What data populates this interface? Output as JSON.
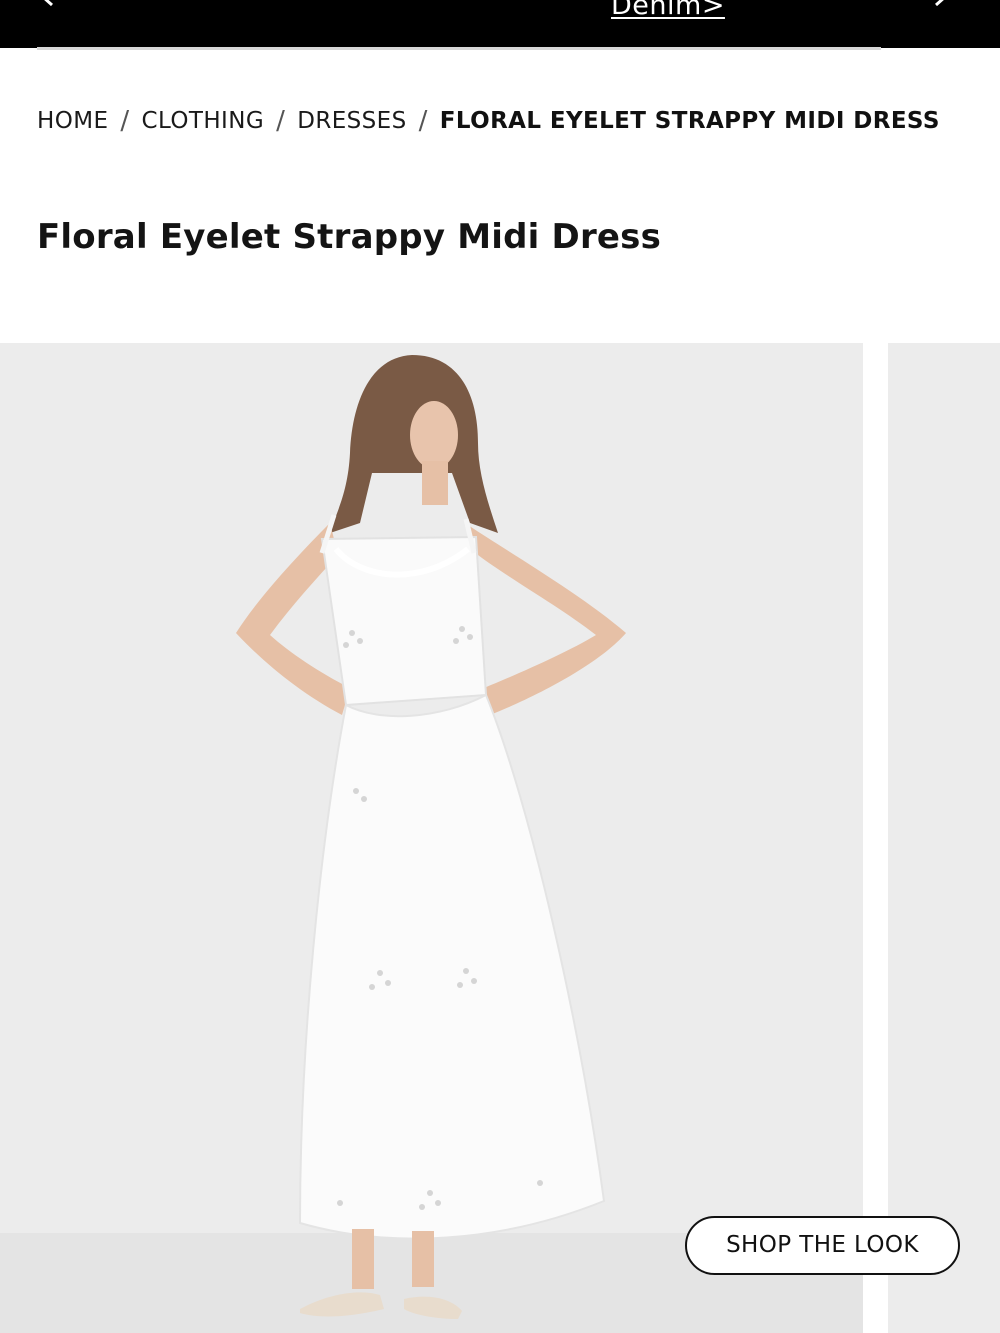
{
  "promo": {
    "link_text": "Denim>",
    "prev_icon": "chevron-left-icon",
    "next_icon": "chevron-right-icon"
  },
  "breadcrumb": {
    "items": [
      "HOME",
      "CLOTHING",
      "DRESSES"
    ],
    "current": "FLORAL EYELET STRAPPY MIDI DRESS",
    "separator": "/"
  },
  "product": {
    "title": "Floral Eyelet Strappy Midi Dress"
  },
  "gallery": {
    "shop_the_look_label": "SHOP THE LOOK"
  },
  "colors": {
    "banner": "#000000",
    "image_background": "#ececec",
    "text": "#1a1a1a"
  }
}
